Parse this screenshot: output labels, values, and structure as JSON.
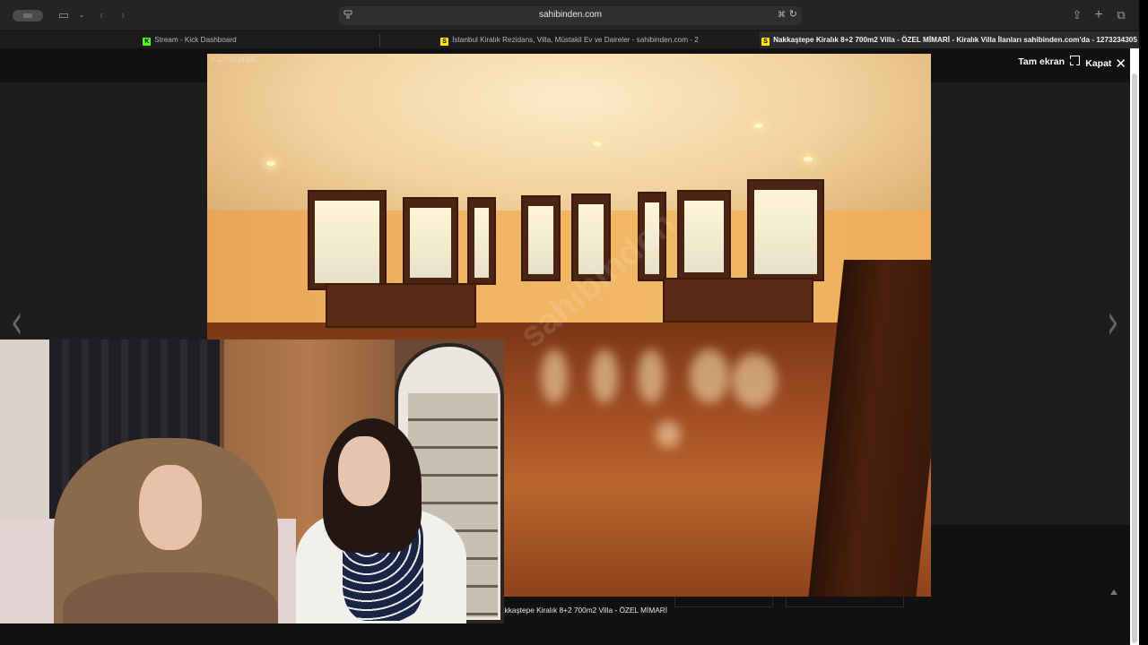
{
  "browser": {
    "url": "sahibinden.com",
    "tabs": [
      {
        "label": "Stream - Kick Dashboard",
        "favicon": "kick-icon"
      },
      {
        "label": "İstanbul Kiralık Rezidans, Villa, Müstakil Ev ve Daireler - sahibinden.com - 2",
        "favicon": "sahibinden-icon"
      },
      {
        "label": "Nakkaştepe Kiralık 8+2 700m2 Villa - ÖZEL MİMARİ - Kiralık Villa İlanları sahibinden.com'da - 1273234305",
        "favicon": "sahibinden-icon"
      }
    ],
    "active_tab": 2
  },
  "viewer": {
    "fullscreen_label": "Tam ekran",
    "close_label": "Kapat",
    "photo_id": "# 1273234305",
    "caption": "akkaştepe Kiralık 8+2 700m2 Villa - ÖZEL MİMARİ",
    "watermark": "sahibinden"
  },
  "colors": {
    "toolbar": "#242426",
    "tabbar": "#1c1c1e",
    "viewer_bg": "#1d1d1d",
    "kick_green": "#53fc18",
    "sahibinden_yellow": "#ffe800"
  }
}
